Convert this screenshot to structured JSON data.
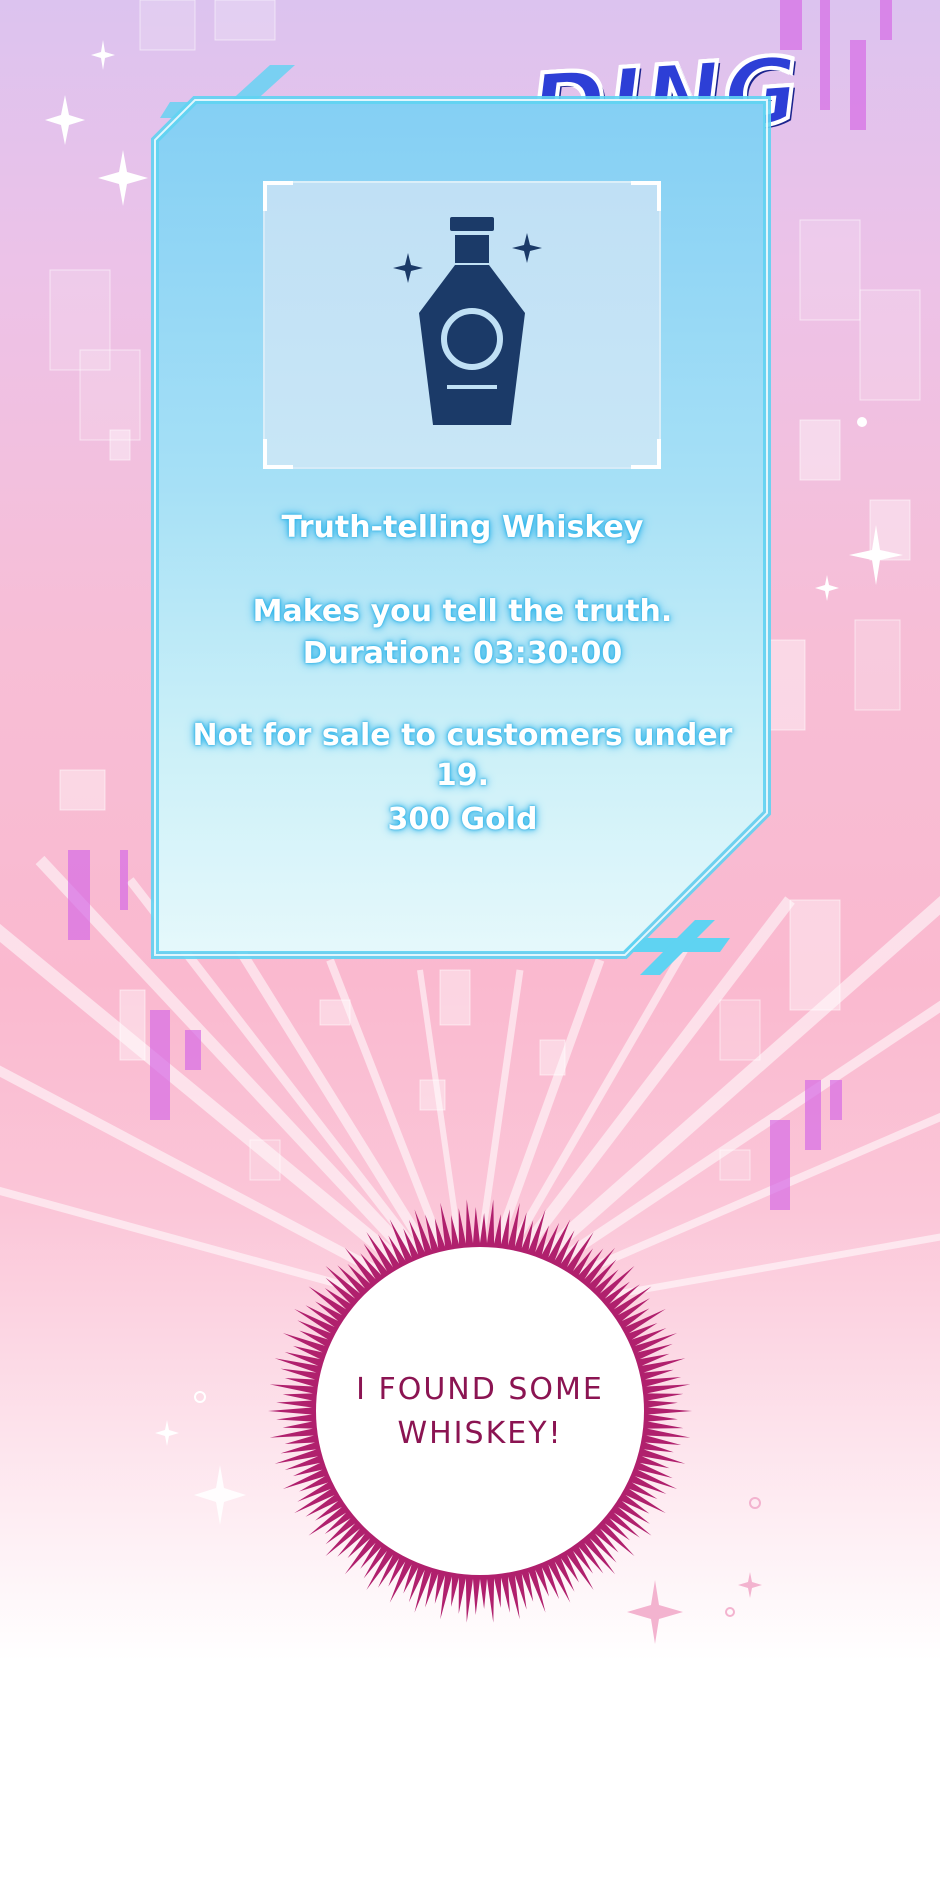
{
  "sound_effect": "DING",
  "item_card": {
    "icon": "whiskey-bottle-icon",
    "name": "Truth-telling Whiskey",
    "description": "Makes you tell the truth.",
    "duration": "Duration: 03:30:00",
    "restriction": "Not for sale to customers under 19.",
    "price": "300 Gold"
  },
  "speech_bubble": {
    "line1": "I FOUND SOME",
    "line2": "WHISKEY!"
  },
  "colors": {
    "panel_blue": "#84cff4",
    "panel_border": "#5fd3f2",
    "icon_navy": "#1b3a68",
    "sfx_blue": "#2d3fd6",
    "bubble_magenta": "#b0206d"
  }
}
